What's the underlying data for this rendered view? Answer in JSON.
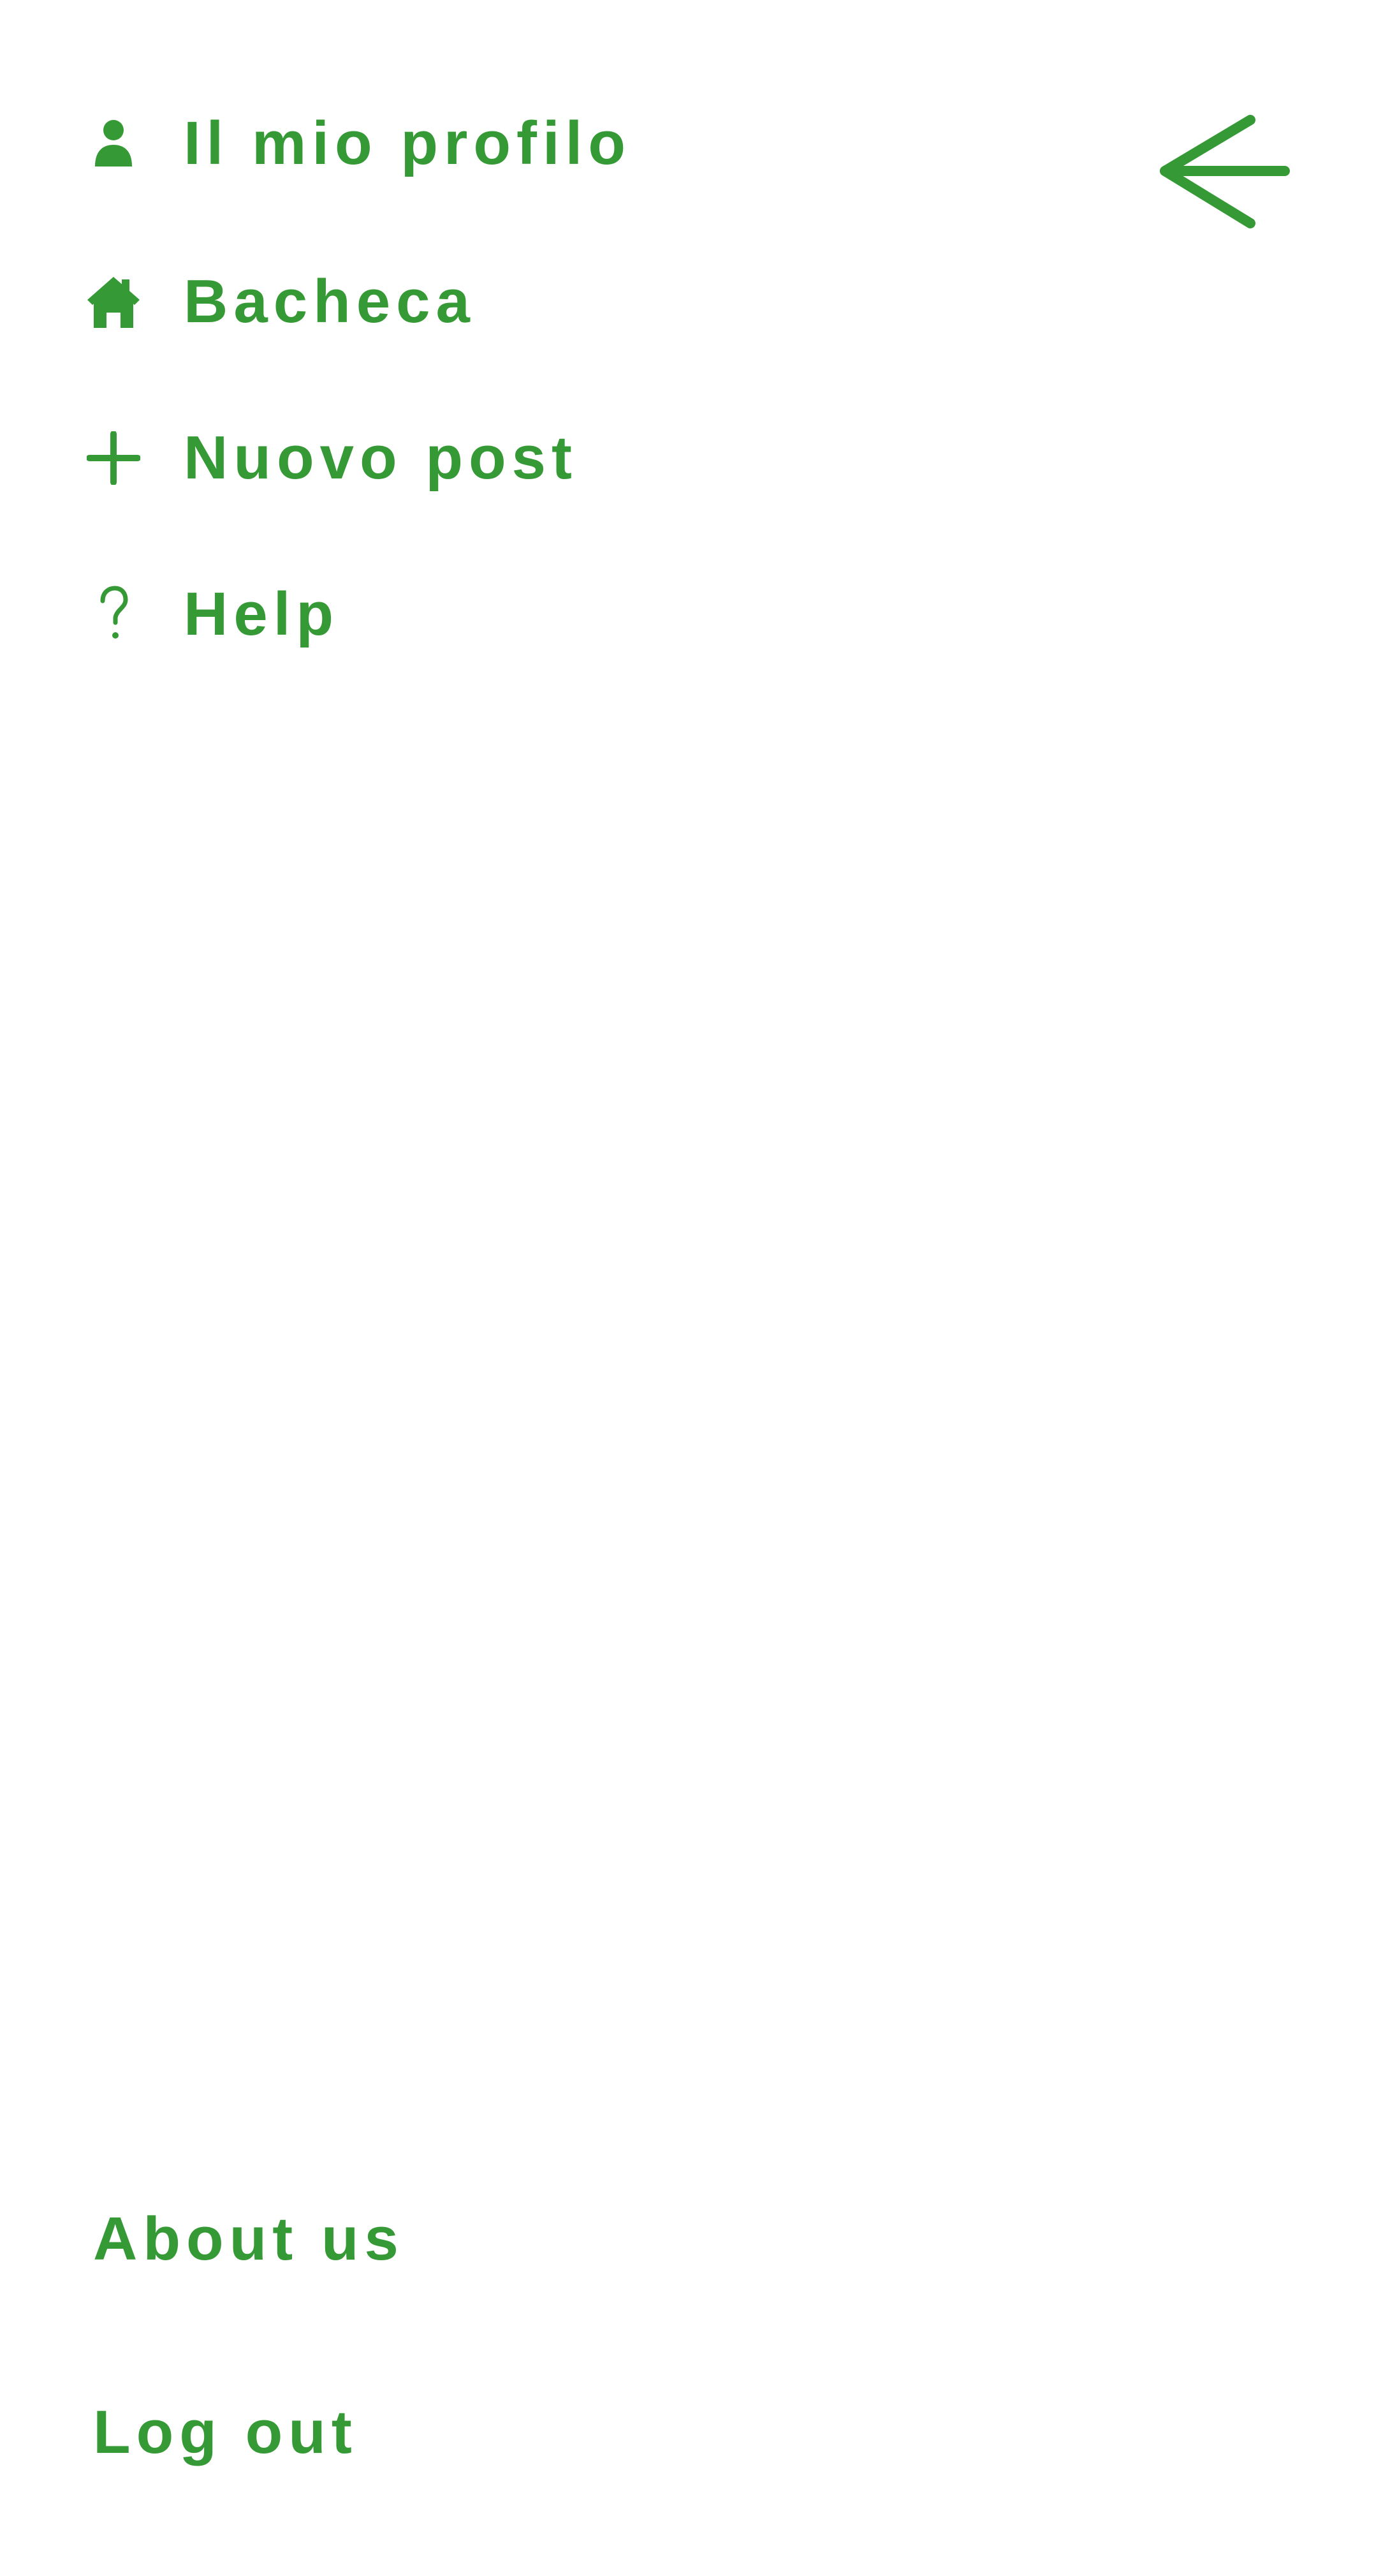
{
  "theme": {
    "accent": "#359a35",
    "background": "#ffffff"
  },
  "back_button": {
    "icon": "arrow-left-icon"
  },
  "menu": {
    "items": [
      {
        "label": "Il mio profilo",
        "icon": "user-icon"
      },
      {
        "label": "Bacheca",
        "icon": "home-icon"
      },
      {
        "label": "Nuovo post",
        "icon": "plus-icon"
      },
      {
        "label": "Help",
        "icon": "question-icon"
      }
    ]
  },
  "footer": {
    "about_label": "About us",
    "logout_label": "Log out"
  }
}
